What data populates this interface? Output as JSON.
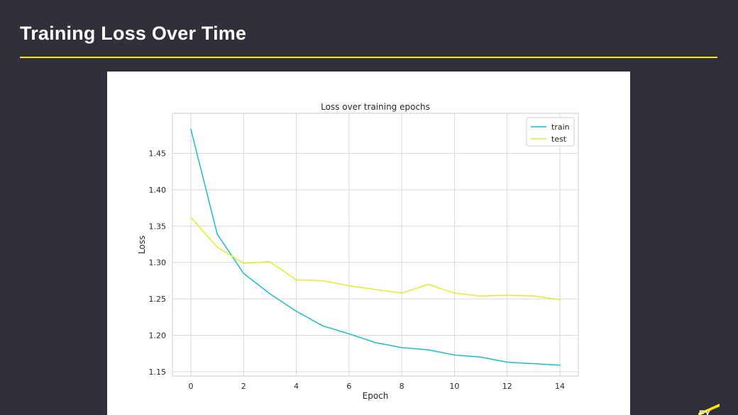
{
  "slide": {
    "title": "Training Loss Over Time",
    "accent_color": "#ffe600",
    "background_color": "#312f3a",
    "logo_text": "EY"
  },
  "chart_data": {
    "type": "line",
    "title": "Loss over training epochs",
    "xlabel": "Epoch",
    "ylabel": "Loss",
    "xlim": [
      -0.7,
      14.7
    ],
    "ylim": [
      1.144,
      1.505
    ],
    "xticks": [
      0,
      2,
      4,
      6,
      8,
      10,
      12,
      14
    ],
    "yticks": [
      1.15,
      1.2,
      1.25,
      1.3,
      1.35,
      1.4,
      1.45
    ],
    "ytick_labels": [
      "1.15",
      "1.20",
      "1.25",
      "1.30",
      "1.35",
      "1.40",
      "1.45"
    ],
    "grid": true,
    "legend_position": "top-right",
    "x": [
      0,
      1,
      2,
      3,
      4,
      5,
      6,
      7,
      8,
      9,
      10,
      11,
      12,
      13,
      14
    ],
    "series": [
      {
        "name": "train",
        "color": "#17becf",
        "values": [
          1.483,
          1.339,
          1.285,
          1.257,
          1.233,
          1.213,
          1.202,
          1.19,
          1.183,
          1.18,
          1.173,
          1.17,
          1.163,
          1.161,
          1.159
        ]
      },
      {
        "name": "test",
        "color": "#e1f01e",
        "values": [
          1.362,
          1.321,
          1.299,
          1.301,
          1.276,
          1.275,
          1.268,
          1.263,
          1.258,
          1.27,
          1.258,
          1.254,
          1.255,
          1.254,
          1.249
        ]
      }
    ]
  }
}
